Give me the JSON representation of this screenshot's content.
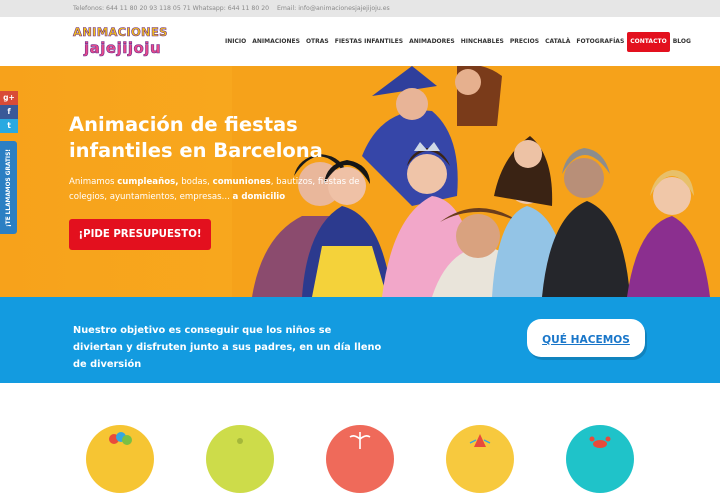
{
  "topbar": {
    "phones": "Telefonos: 644 11 80 20   93 118 05 71 Whatsapp: 644 11 80 20",
    "email": "Email: info@animacionesjajejijoju.es"
  },
  "logo": {
    "line1": "ANIMACIONES",
    "line2": "jajejijoju"
  },
  "nav": {
    "items": [
      "INICIO",
      "ANIMACIONES",
      "OTRAS",
      "FIESTAS INFANTILES",
      "ANIMADORES",
      "HINCHABLES",
      "PRECIOS",
      "CATALÀ",
      "FOTOGRAFÍAS",
      "CONTACTO",
      "BLOG"
    ],
    "active_index": 9
  },
  "social": {
    "gplus": "g+",
    "facebook": "f",
    "twitter": "t",
    "callback": "¡TE LLAMAMOS GRATIS!"
  },
  "hero": {
    "title": "Animación de fiestas infantiles en Barcelona",
    "sub_prefix": "Animamos ",
    "sub_b1": "cumpleaños,",
    "sub_mid1": " bodas, ",
    "sub_b2": "comuniones",
    "sub_mid2": ", bautizos, fiestas de colegios, ayuntamientos, empresas... ",
    "sub_b3": "a domicilio",
    "cta": "¡PIDE PRESUPUESTO!"
  },
  "band": {
    "text": "Nuestro objetivo es conseguir que los niños se diviertan y disfruten junto a sus padres, en un día lleno de diversión",
    "button": "QUÉ HACEMOS"
  },
  "colors": {
    "accent_red": "#e3101e",
    "hero_orange": "#f8ab1f",
    "band_blue": "#139be0",
    "button_text_blue": "#1976c9"
  },
  "circles": {
    "icons": [
      "balloons-icon",
      "circle-icon",
      "palm-tree-icon",
      "party-hat-icon",
      "crab-icon"
    ],
    "colors": [
      "#f6c533",
      "#cddc4a",
      "#ef6a5a",
      "#f7c93e",
      "#1fc3c9"
    ]
  }
}
